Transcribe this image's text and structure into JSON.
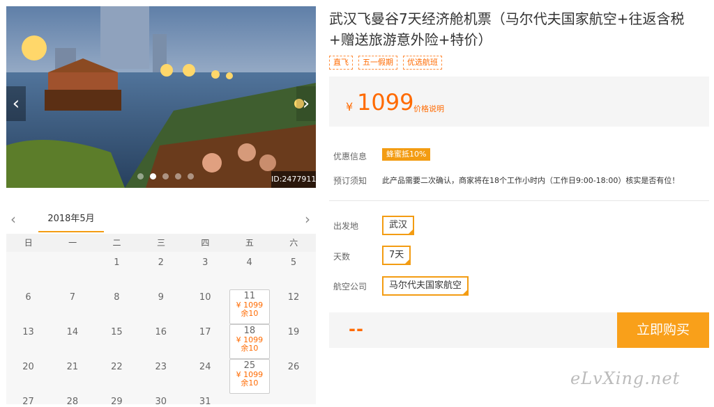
{
  "gallery": {
    "image_id": "ID:2477911",
    "prev_glyph": "‹",
    "next_glyph": "›",
    "dots": 5,
    "active_dot": 1
  },
  "calendar": {
    "month_label": "2018年5月",
    "prev_glyph": "‹",
    "next_glyph": "›",
    "weekdays": [
      "日",
      "一",
      "二",
      "三",
      "四",
      "五",
      "六"
    ],
    "weeks": [
      [
        null,
        null,
        "1",
        "2",
        "3",
        "4",
        "5"
      ],
      [
        "6",
        "7",
        "8",
        "9",
        "10",
        {
          "day": "11",
          "price": "¥ 1099",
          "left": "余10"
        },
        "12"
      ],
      [
        "13",
        "14",
        "15",
        "16",
        "17",
        {
          "day": "18",
          "price": "¥ 1099",
          "left": "余10"
        },
        "19"
      ],
      [
        "20",
        "21",
        "22",
        "23",
        "24",
        {
          "day": "25",
          "price": "¥ 1099",
          "left": "余10"
        },
        "26"
      ],
      [
        "27",
        "28",
        "29",
        "30",
        "31",
        null,
        null
      ]
    ]
  },
  "product": {
    "title": "武汉飞曼谷7天经济舱机票（马尔代夫国家航空+往返含税+赠送旅游意外险+特价）",
    "tags": [
      "直飞",
      "五一假期",
      "优选航班"
    ],
    "currency": "¥",
    "price": "1099",
    "price_explain": "价格说明",
    "promo_label": "优惠信息",
    "promo_badge": "蜂蜜抵10%",
    "notice_label": "预订须知",
    "notice_text": "此产品需要二次确认，商家将在18个工作小时内（工作日9:00-18:00）核实是否有位！",
    "departure_label": "出发地",
    "departure_value": "武汉",
    "days_label": "天数",
    "days_value": "7天",
    "airline_label": "航空公司",
    "airline_value": "马尔代夫国家航空",
    "total_placeholder": "--",
    "buy_label": "立即购买"
  },
  "watermark": "eLvXing.net",
  "colors": {
    "accent": "#ff6a00",
    "button": "#f9a01a",
    "border": "#f39c12"
  }
}
